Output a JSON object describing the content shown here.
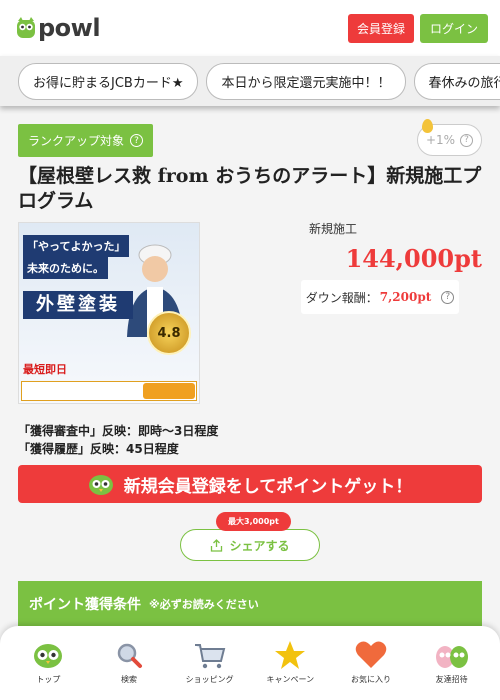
{
  "header": {
    "logo_text": "powl",
    "register_label": "会員登録",
    "login_label": "ログイン"
  },
  "campaigns": [
    {
      "label": "お得に貯まるJCBカード★"
    },
    {
      "label": "本日から限定還元実施中！！"
    },
    {
      "label": "春休みの旅行"
    }
  ],
  "offer": {
    "rank_badge_label": "ランクアップ対象",
    "boost_label": "+1%",
    "title": "【屋根壁レス救 from おうちのアラート】新規施工プログラム",
    "kind": "新規施工",
    "points": "144,000pt",
    "down_label": "ダウン報酬：",
    "down_amount": "7,200pt",
    "reflect_line1": "「獲得審査中」反映：即時～3日程度",
    "reflect_line2": "「獲得履歴」反映：45日程度"
  },
  "banner": {
    "catch1": "「やってよかった」",
    "catch2": "未来のために。",
    "headline": "外壁塗装",
    "rating": "4.8",
    "fast_text": "最短即日"
  },
  "cta": {
    "label": "新規会員登録をしてポイントゲット！"
  },
  "share": {
    "max_badge": "最大3,000pt",
    "label": "シェアする"
  },
  "conditions": {
    "title": "ポイント獲得条件",
    "note": "※必ずお読みください"
  },
  "bottom_nav": [
    {
      "label": "トップ",
      "icon": "owl-icon"
    },
    {
      "label": "検索",
      "icon": "search-icon"
    },
    {
      "label": "ショッピング",
      "icon": "cart-icon"
    },
    {
      "label": "キャンペーン",
      "icon": "star-icon"
    },
    {
      "label": "お気に入り",
      "icon": "heart-icon"
    },
    {
      "label": "友達招待",
      "icon": "friends-icon"
    }
  ],
  "colors": {
    "brand_green": "#7bc142",
    "accent_red": "#ee3b3b"
  }
}
